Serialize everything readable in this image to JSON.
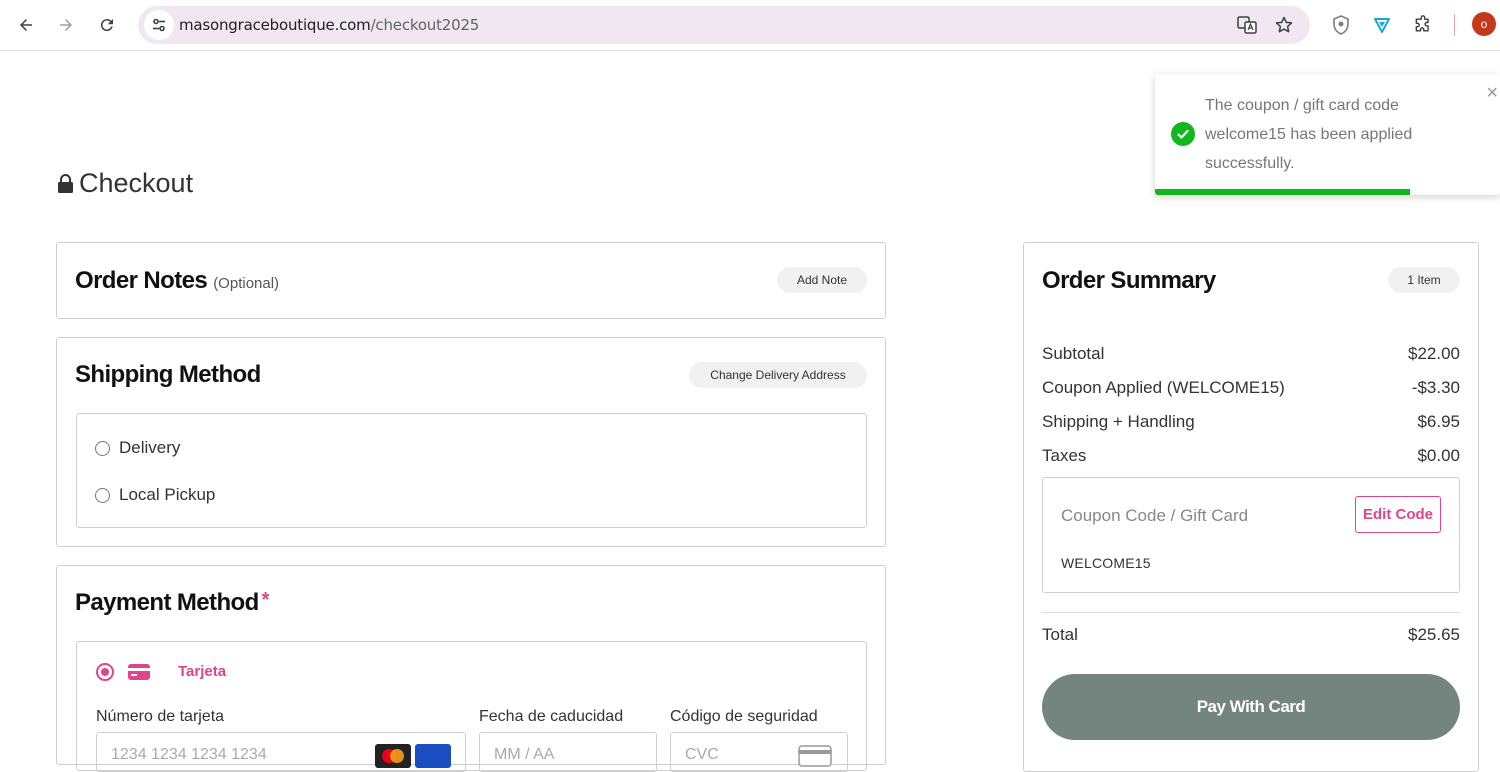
{
  "browser": {
    "url_host": "masongraceboutique.com",
    "url_path": "/checkout2025",
    "avatar_letter": "o"
  },
  "page": {
    "title": "Checkout"
  },
  "order_notes": {
    "title": "Order Notes",
    "optional": "(Optional)",
    "add_note_label": "Add Note"
  },
  "shipping": {
    "title": "Shipping Method",
    "change_address_label": "Change Delivery Address",
    "options": [
      "Delivery",
      "Local Pickup"
    ]
  },
  "payment": {
    "title": "Payment Method",
    "required_mark": "*",
    "method_label": "Tarjeta",
    "card_number_label": "Número de tarjeta",
    "card_number_placeholder": "1234 1234 1234 1234",
    "expiry_label": "Fecha de caducidad",
    "expiry_placeholder": "MM / AA",
    "cvc_label": "Código de seguridad",
    "cvc_placeholder": "CVC"
  },
  "summary": {
    "title": "Order Summary",
    "item_count": "1 Item",
    "rows": [
      {
        "label": "Subtotal",
        "value": "$22.00"
      },
      {
        "label": "Coupon Applied (WELCOME15)",
        "value": "-$3.30"
      },
      {
        "label": "Shipping + Handling",
        "value": "$6.95"
      },
      {
        "label": "Taxes",
        "value": "$0.00"
      }
    ],
    "coupon_placeholder": "Coupon Code / Gift Card",
    "edit_code_label": "Edit Code",
    "coupon_value": "WELCOME15",
    "total_label": "Total",
    "total_value": "$25.65",
    "pay_button_label": "Pay With Card"
  },
  "toast": {
    "message": "The coupon / gift card code welcome15 has been applied successfully.",
    "close_glyph": "×",
    "progress_fraction": 0.74
  },
  "colors": {
    "accent_pink": "#e0458a",
    "success_green": "#14b61f",
    "pay_button": "#748580"
  }
}
